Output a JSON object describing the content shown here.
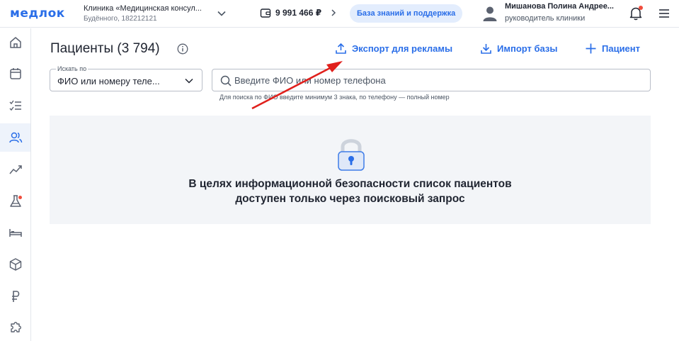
{
  "header": {
    "logo": "медлок",
    "clinic_name": "Клиника «Медицинская консул...",
    "clinic_address": "Будённого, 182212121",
    "balance": "9 991 466 ₽",
    "knowledge_base": "База знаний и поддержка",
    "user_name": "Мишанова Полина Андрее...",
    "user_role": "руководитель клиники"
  },
  "sidebar": {
    "items": [
      {
        "icon": "home-icon"
      },
      {
        "icon": "calendar-icon"
      },
      {
        "icon": "checklist-icon"
      },
      {
        "icon": "patients-icon",
        "active": true
      },
      {
        "icon": "analytics-icon"
      },
      {
        "icon": "lab-flask-icon",
        "badge": true
      },
      {
        "icon": "bed-icon"
      },
      {
        "icon": "box-icon"
      },
      {
        "icon": "ruble-icon"
      },
      {
        "icon": "puzzle-icon"
      }
    ]
  },
  "main": {
    "title": "Пациенты (3 794)",
    "actions": {
      "export": "Экспорт для рекламы",
      "import": "Импорт базы",
      "add_patient": "Пациент"
    },
    "search_by": {
      "label": "Искать по",
      "value": "ФИО или номеру теле..."
    },
    "search": {
      "placeholder": "Введите ФИО или номер телефона",
      "hint": "Для поиска по ФИО введите минимум 3 знака, по телефону — полный номер"
    },
    "notice": {
      "line1": "В целях информационной безопасности список пациентов",
      "line2": "доступен только через поисковый запрос"
    }
  },
  "colors": {
    "accent": "#2a6ee8",
    "badge": "#f04d3d",
    "annotation": "#e0201c",
    "notice_bg": "#f3f5f8"
  }
}
